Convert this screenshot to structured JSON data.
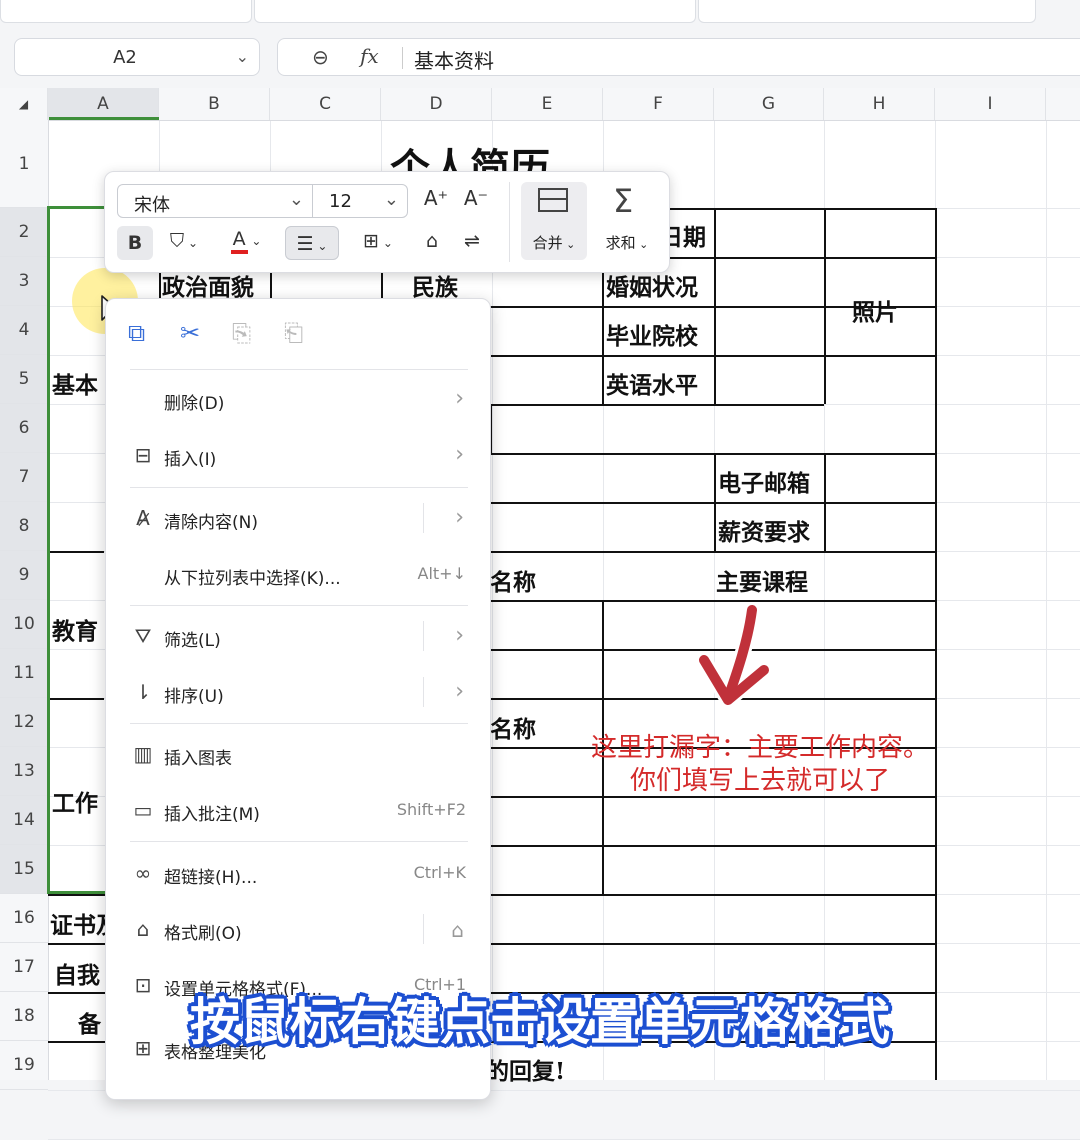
{
  "formula_bar": {
    "cell_ref": "A2",
    "fx_label": "fx",
    "value": "基本资料"
  },
  "columns": [
    "A",
    "B",
    "C",
    "D",
    "E",
    "F",
    "G",
    "H",
    "I"
  ],
  "rows": [
    "1",
    "2",
    "3",
    "4",
    "5",
    "6",
    "7",
    "8",
    "9",
    "10",
    "11",
    "12",
    "13",
    "14",
    "15",
    "16",
    "17",
    "18",
    "19"
  ],
  "sheet_cells": {
    "title": "个人简历",
    "date_label": "日期",
    "political": "政治面貌",
    "ethnicity": "民族",
    "marital": "婚姻状况",
    "photo": "照片",
    "school": "毕业院校",
    "english": "英语水平",
    "basic": "基本",
    "email": "电子邮箱",
    "salary": "薪资要求",
    "edu_name": "名称",
    "main_course": "主要课程",
    "edu": "教育",
    "work_name": "名称",
    "work": "工作",
    "cert": "证书及",
    "self": "自我",
    "remark": "备",
    "reply": "的回复!"
  },
  "toolbar": {
    "font_name": "宋体",
    "font_size": "12",
    "bold": "B",
    "font_color_letter": "A",
    "merge_label": "合并",
    "sum_label": "求和",
    "accent_red": "#e02020"
  },
  "context_menu": {
    "items": [
      {
        "label": "删除(D)",
        "shortcut": ""
      },
      {
        "label": "插入(I)",
        "shortcut": ""
      },
      {
        "label": "清除内容(N)",
        "shortcut": ""
      },
      {
        "label": "从下拉列表中选择(K)...",
        "shortcut": "Alt+↓"
      },
      {
        "label": "筛选(L)",
        "shortcut": ""
      },
      {
        "label": "排序(U)",
        "shortcut": ""
      },
      {
        "label": "插入图表",
        "shortcut": ""
      },
      {
        "label": "插入批注(M)",
        "shortcut": "Shift+F2"
      },
      {
        "label": "超链接(H)...",
        "shortcut": "Ctrl+K"
      },
      {
        "label": "格式刷(O)",
        "shortcut": ""
      },
      {
        "label": "设置单元格格式(F)...",
        "shortcut": "Ctrl+1"
      },
      {
        "label": "表格整理美化",
        "shortcut": ""
      }
    ]
  },
  "annotation": {
    "line1": "这里打漏字：主要工作内容。",
    "line2": "你们填写上去就可以了",
    "color": "#d42a2a"
  },
  "caption": "按鼠标右键点击设置单元格格式"
}
